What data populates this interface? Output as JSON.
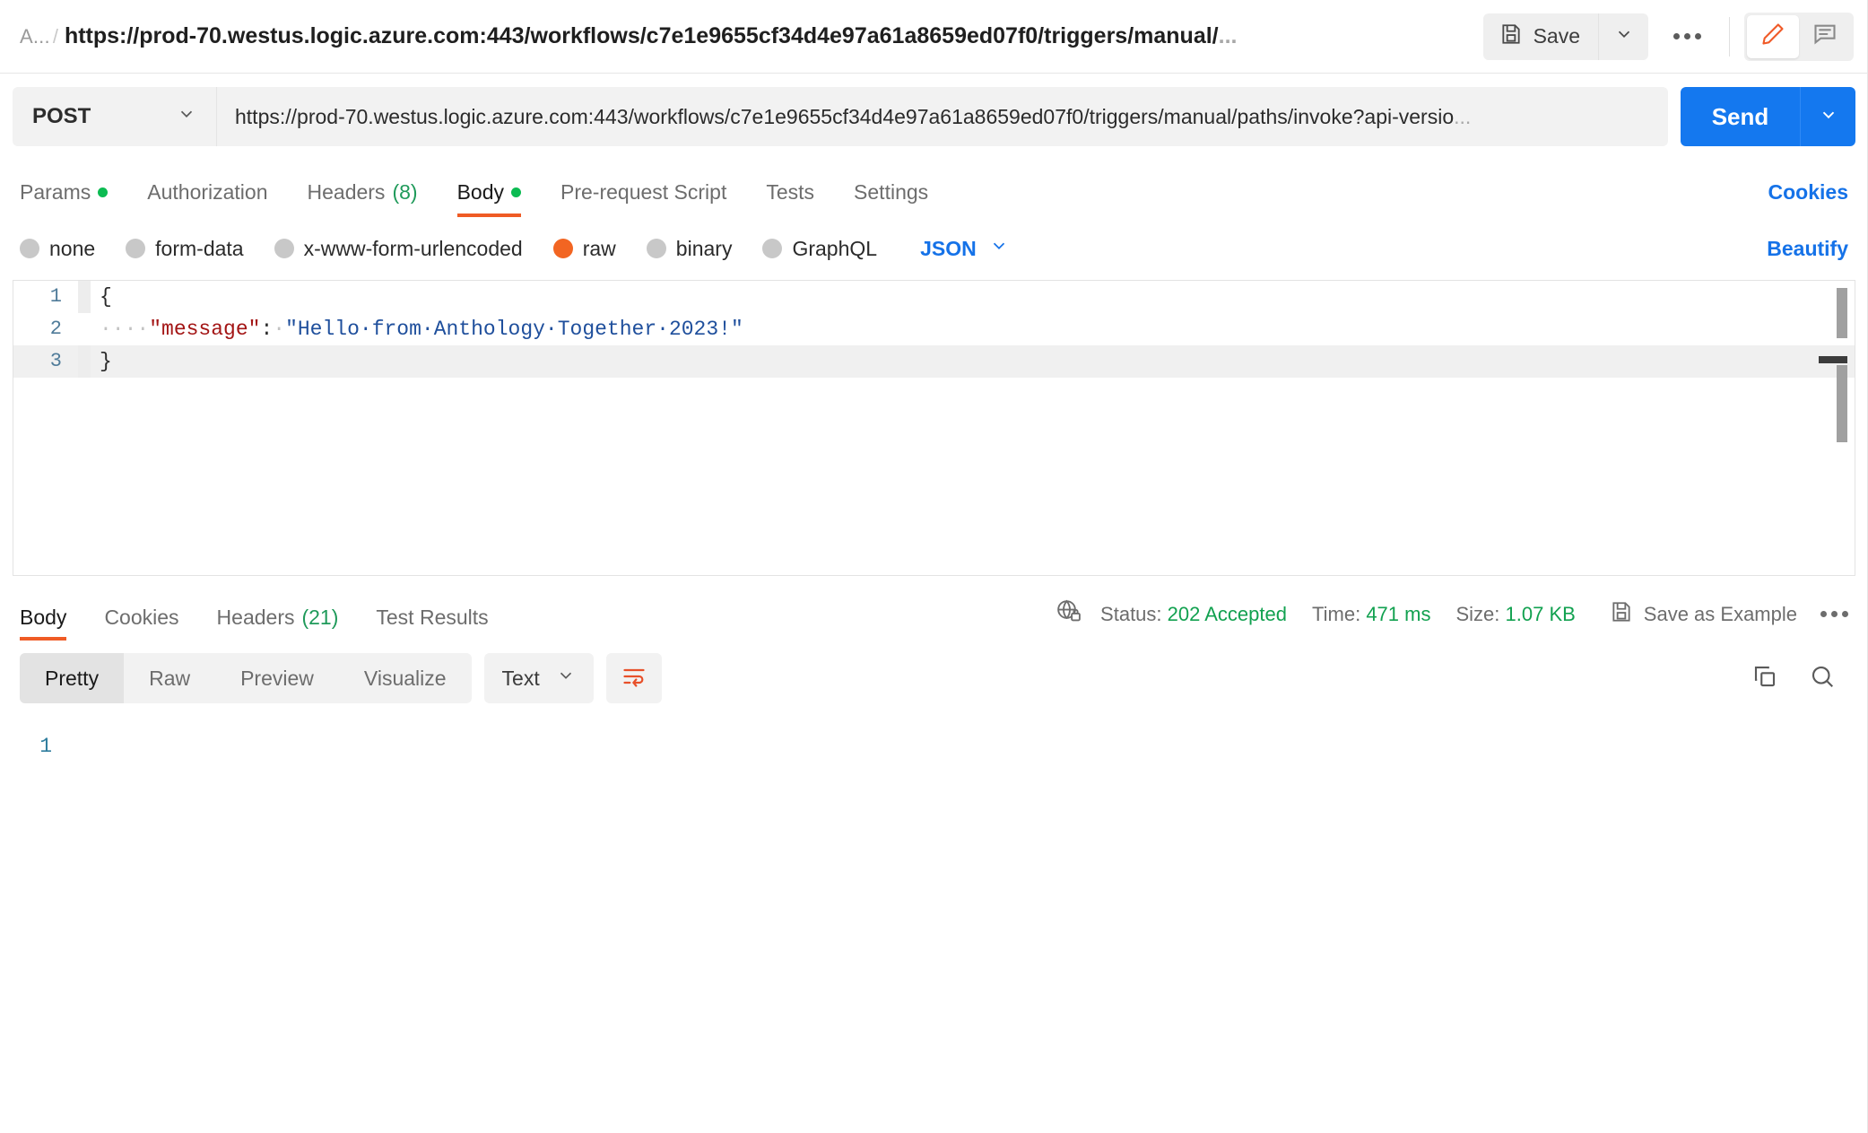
{
  "topbar": {
    "crumb_prefix": "A...",
    "crumb_separator": "/",
    "title": "https://prod-70.westus.logic.azure.com:443/workflows/c7e1e9655cf34d4e97a61a8659ed07f0/triggers/manual/",
    "title_ellipsis": "...",
    "save_label": "Save",
    "save_icon": "floppy-disk-icon",
    "caret_icon": "chevron-down-icon",
    "more_icon": "more-horizontal-icon",
    "edit_icon": "pencil-icon",
    "comment_icon": "comment-icon"
  },
  "request": {
    "method": "POST",
    "method_caret": "chevron-down-icon",
    "url": "https://prod-70.westus.logic.azure.com:443/workflows/c7e1e9655cf34d4e97a61a8659ed07f0/triggers/manual/paths/invoke?api-versio",
    "url_ellipsis": "...",
    "send_label": "Send",
    "send_caret": "chevron-down-icon",
    "tabs": [
      {
        "label": "Params",
        "badge_dot": true,
        "active": false
      },
      {
        "label": "Authorization",
        "active": false
      },
      {
        "label": "Headers",
        "count": "(8)",
        "active": false
      },
      {
        "label": "Body",
        "badge_dot": true,
        "active": true
      },
      {
        "label": "Pre-request Script",
        "active": false
      },
      {
        "label": "Tests",
        "active": false
      },
      {
        "label": "Settings",
        "active": false
      }
    ],
    "cookies_link": "Cookies",
    "body_types": [
      {
        "label": "none",
        "selected": false
      },
      {
        "label": "form-data",
        "selected": false
      },
      {
        "label": "x-www-form-urlencoded",
        "selected": false
      },
      {
        "label": "raw",
        "selected": true
      },
      {
        "label": "binary",
        "selected": false
      },
      {
        "label": "GraphQL",
        "selected": false
      }
    ],
    "raw_format": "JSON",
    "raw_format_caret": "chevron-down-icon",
    "beautify_link": "Beautify",
    "body_editor": {
      "lines": [
        {
          "num": "1",
          "brace": "{"
        },
        {
          "num": "2",
          "indent": "····",
          "key": "\"message\"",
          "colon": ":",
          "space": "·",
          "value": "\"Hello·from·Anthology·Together·2023!\""
        },
        {
          "num": "3",
          "brace": "}"
        }
      ],
      "raw_text": "{\n    \"message\": \"Hello from Anthology Together 2023!\"\n}"
    }
  },
  "response": {
    "tabs": [
      {
        "label": "Body",
        "active": true
      },
      {
        "label": "Cookies",
        "active": false
      },
      {
        "label": "Headers",
        "count": "(21)",
        "active": false
      },
      {
        "label": "Test Results",
        "active": false
      }
    ],
    "network_icon": "globe-lock-icon",
    "status_label": "Status:",
    "status_value": "202 Accepted",
    "time_label": "Time:",
    "time_value": "471 ms",
    "size_label": "Size:",
    "size_value": "1.07 KB",
    "save_example_icon": "floppy-disk-icon",
    "save_example_label": "Save as Example",
    "more_icon": "more-horizontal-icon",
    "view_modes": [
      {
        "label": "Pretty",
        "active": true
      },
      {
        "label": "Raw",
        "active": false
      },
      {
        "label": "Preview",
        "active": false
      },
      {
        "label": "Visualize",
        "active": false
      }
    ],
    "format": "Text",
    "format_caret": "chevron-down-icon",
    "wrap_icon": "word-wrap-icon",
    "copy_icon": "copy-icon",
    "search_icon": "search-icon",
    "body_lines": [
      {
        "num": "1",
        "text": ""
      }
    ]
  },
  "colors": {
    "accent_orange": "#ef5b25",
    "send_blue": "#1478ef",
    "link_blue": "#1572e8",
    "status_green": "#12a150",
    "dot_green": "#0cbb52",
    "radio_selected": "#f26522"
  }
}
